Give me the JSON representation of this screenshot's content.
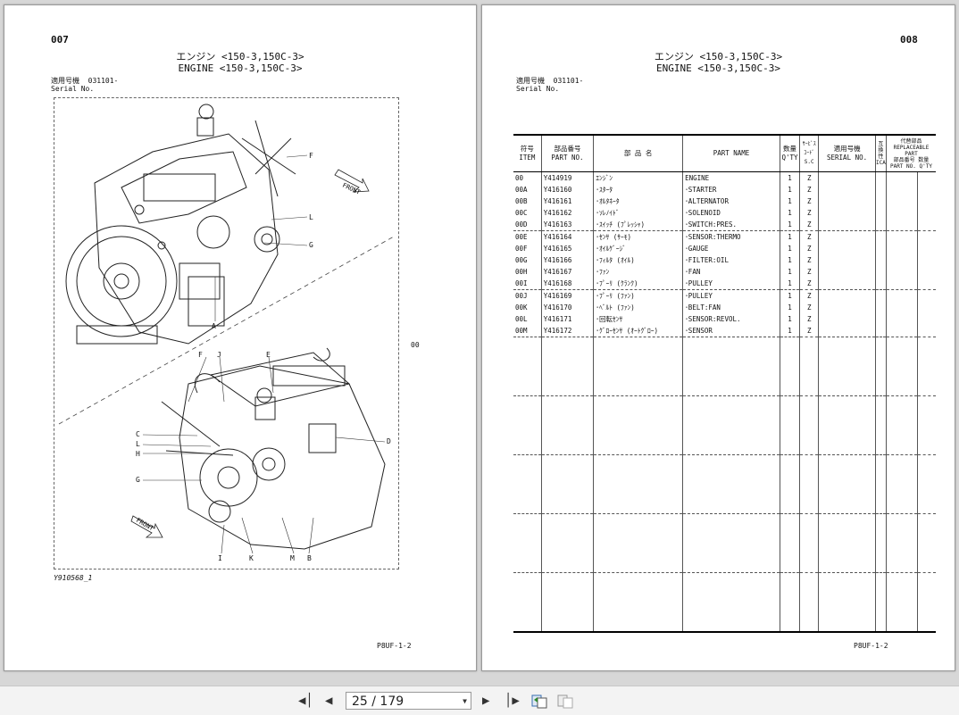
{
  "left_page": {
    "page_number": "007",
    "title_jp": "エンジン <150-3,150C-3>",
    "title_en": "ENGINE <150-3,150C-3>",
    "serial_jp": "適用号機",
    "serial_en": "Serial No.",
    "serial_value": "031101-",
    "drawing": {
      "front_label": "FRONT",
      "item_labels": [
        "F",
        "L",
        "G",
        "A",
        "F",
        "J",
        "E",
        "C",
        "L",
        "H",
        "G",
        "D",
        "I",
        "K",
        "M",
        "B"
      ],
      "assembly_ref": "00"
    },
    "figure_id": "Y910568_1",
    "footer_code": "P8UF-1-2"
  },
  "right_page": {
    "page_number": "008",
    "title_jp": "エンジン <150-3,150C-3>",
    "title_en": "ENGINE <150-3,150C-3>",
    "serial_jp": "適用号機",
    "serial_en": "Serial No.",
    "serial_value": "031101-",
    "table": {
      "headers": {
        "item_jp": "符号",
        "item_en": "ITEM",
        "part_no_jp": "部品番号",
        "part_no_en": "PART NO.",
        "name_jp": "部 品 名",
        "part_name": "PART NAME",
        "qty_jp": "数量",
        "qty_en": "Q'TY",
        "sc_jp1": "ｻｰﾋﾞｽ",
        "sc_jp2": "ｺｰﾄﾞ",
        "sc_en": "S.C",
        "serial_jp": "適用号機",
        "serial_en": "SERIAL NO.",
        "ica_jp": "互換性",
        "ica_en": "ICA",
        "replaceable_jp": "代替部品",
        "replaceable_en": "REPLACEABLE PART",
        "rep_part_no_jp": "部品番号",
        "rep_part_no_en": "PART NO.",
        "rep_qty_jp": "数量",
        "rep_qty_en": "Q'TY"
      },
      "rows": [
        {
          "item": "00",
          "part_no": "Y414919",
          "name_jp": "ｴﾝｼﾞﾝ",
          "part_name": "ENGINE",
          "qty": "1",
          "sc": "Z"
        },
        {
          "item": "00A",
          "part_no": "Y416160",
          "name_jp": "･ｽﾀｰﾀ",
          "part_name": "･STARTER",
          "qty": "1",
          "sc": "Z"
        },
        {
          "item": "00B",
          "part_no": "Y416161",
          "name_jp": "･ｵﾙﾀﾈｰﾀ",
          "part_name": "･ALTERNATOR",
          "qty": "1",
          "sc": "Z"
        },
        {
          "item": "00C",
          "part_no": "Y416162",
          "name_jp": "･ｿﾚﾉｲﾄﾞ",
          "part_name": "･SOLENOID",
          "qty": "1",
          "sc": "Z"
        },
        {
          "item": "00D",
          "part_no": "Y416163",
          "name_jp": "･ｽｲｯﾁ (ﾌﾟﾚｯｼｬ)",
          "part_name": "･SWITCH:PRES.",
          "qty": "1",
          "sc": "Z"
        },
        {
          "item": "00E",
          "part_no": "Y416164",
          "name_jp": "･ｾﾝｻ (ｻｰﾓ)",
          "part_name": "･SENSOR:THERMO",
          "qty": "1",
          "sc": "Z"
        },
        {
          "item": "00F",
          "part_no": "Y416165",
          "name_jp": "･ｵｲﾙｹﾞｰｼﾞ",
          "part_name": "･GAUGE",
          "qty": "1",
          "sc": "Z"
        },
        {
          "item": "00G",
          "part_no": "Y416166",
          "name_jp": "･ﾌｨﾙﾀ (ｵｲﾙ)",
          "part_name": "･FILTER:OIL",
          "qty": "1",
          "sc": "Z"
        },
        {
          "item": "00H",
          "part_no": "Y416167",
          "name_jp": "･ﾌｧﾝ",
          "part_name": "･FAN",
          "qty": "1",
          "sc": "Z"
        },
        {
          "item": "00I",
          "part_no": "Y416168",
          "name_jp": "･ﾌﾟｰﾘ (ｸﾗﾝｸ)",
          "part_name": "･PULLEY",
          "qty": "1",
          "sc": "Z"
        },
        {
          "item": "00J",
          "part_no": "Y416169",
          "name_jp": "･ﾌﾟｰﾘ (ﾌｧﾝ)",
          "part_name": "･PULLEY",
          "qty": "1",
          "sc": "Z"
        },
        {
          "item": "00K",
          "part_no": "Y416170",
          "name_jp": "･ﾍﾞﾙﾄ (ﾌｧﾝ)",
          "part_name": "･BELT:FAN",
          "qty": "1",
          "sc": "Z"
        },
        {
          "item": "00L",
          "part_no": "Y416171",
          "name_jp": "･回転ｾﾝｻ",
          "part_name": "･SENSOR:REVOL.",
          "qty": "1",
          "sc": "Z"
        },
        {
          "item": "00M",
          "part_no": "Y416172",
          "name_jp": "･ｸﾞﾛｰｾﾝｻ (ｵｰﾄｸﾞﾛｰ)",
          "part_name": "･SENSOR",
          "qty": "1",
          "sc": "Z"
        }
      ]
    },
    "footer_code": "P8UF-1-2"
  },
  "toolbar": {
    "page_indicator": "25 / 179",
    "first_icon": "first-page-icon",
    "prev_icon": "previous-page-icon",
    "next_icon": "next-page-icon",
    "last_icon": "last-page-icon",
    "view_icon_1": "two-page-view-icon",
    "view_icon_2": "single-page-view-icon"
  }
}
